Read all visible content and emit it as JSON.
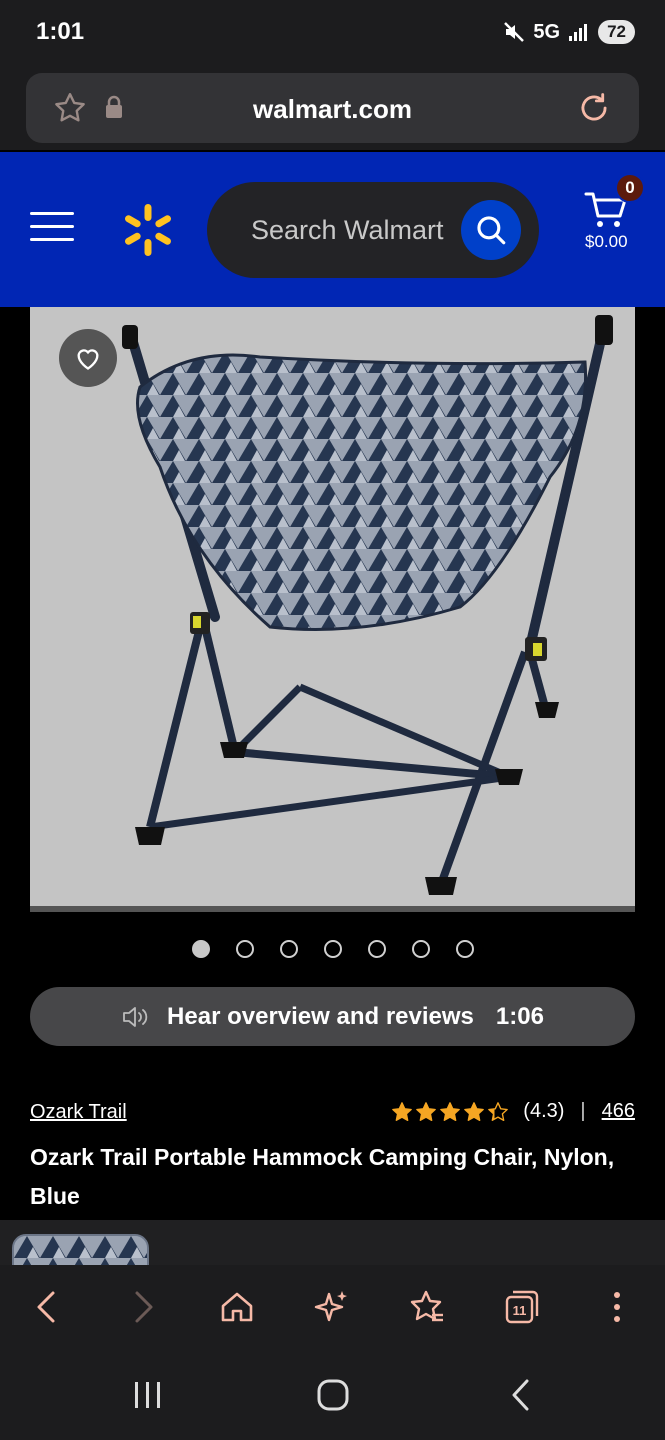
{
  "status_bar": {
    "time": "1:01",
    "network": "5G",
    "battery": "72"
  },
  "browser": {
    "url": "walmart.com",
    "toolbar_icons": [
      "back-icon",
      "forward-icon",
      "home-icon",
      "sparkle-icon",
      "bookmarks-icon",
      "tabs-icon",
      "more-icon"
    ],
    "tab_count": "11"
  },
  "header": {
    "search_placeholder": "Search Walmart",
    "cart_count": "0",
    "cart_total": "$0.00"
  },
  "gallery": {
    "dot_count": 7,
    "active_index": 0
  },
  "audio": {
    "label": "Hear overview and reviews",
    "duration": "1:06"
  },
  "product": {
    "brand": "Ozark Trail",
    "rating_text": "(4.3)",
    "rating_value": 4.3,
    "review_count": "466",
    "title": "Ozark Trail Portable Hammock Camping Chair, Nylon, Blue"
  },
  "colors": {
    "walmart_blue": "#0126b4",
    "spark_yellow": "#ffc220",
    "star_color": "#f5a623",
    "accent_pink": "#f6b9a7"
  }
}
